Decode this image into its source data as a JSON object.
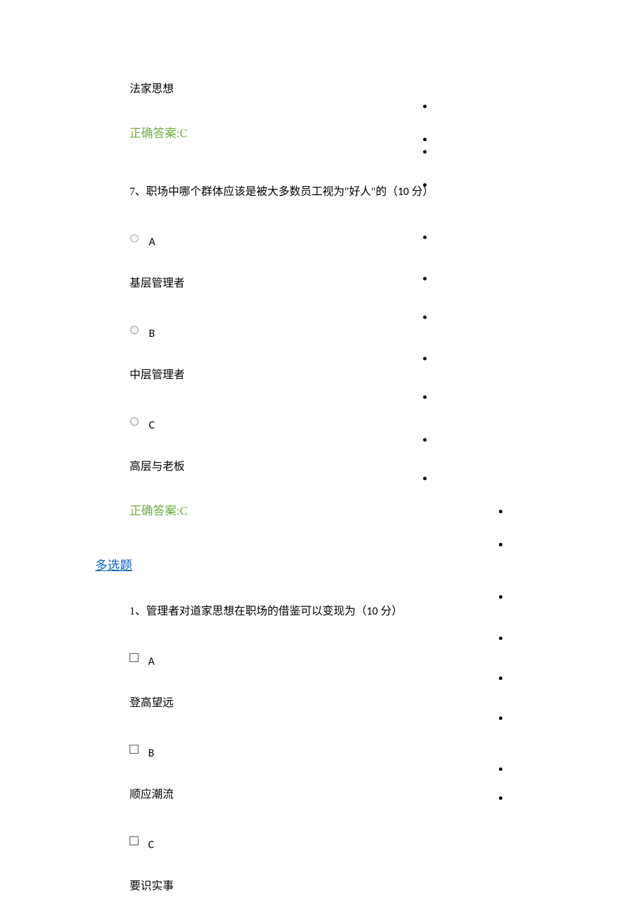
{
  "q6": {
    "partial_option_text": "法家思想",
    "answer": "正确答案:C"
  },
  "q7": {
    "stem_prefix": "7、职场中哪个群体应该是被大多数员工视为\"好人\"的（",
    "points": "10",
    "stem_suffix": " 分）",
    "options": [
      {
        "letter": "A",
        "text": "基层管理者"
      },
      {
        "letter": "B",
        "text": "中层管理者"
      },
      {
        "letter": "C",
        "text": "高层与老板"
      }
    ],
    "answer": "正确答案:C"
  },
  "section2": {
    "title": "多选题"
  },
  "mq1": {
    "stem_prefix": "1、管理者对道家思想在职场的借鉴可以变现为（",
    "points": "10",
    "stem_suffix": " 分）",
    "options": [
      {
        "letter": "A",
        "text": "登高望远"
      },
      {
        "letter": "B",
        "text": "顺应潮流"
      },
      {
        "letter": "C",
        "text": "要识实事"
      }
    ]
  }
}
